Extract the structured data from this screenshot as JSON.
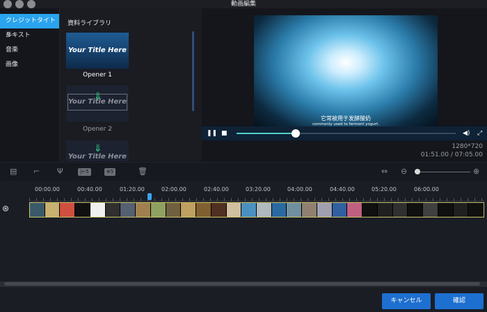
{
  "window": {
    "title": "動画編集"
  },
  "categories": [
    {
      "label": "クレジットタイトル",
      "active": true
    },
    {
      "label": "テキスト",
      "active": false
    },
    {
      "label": "音楽",
      "active": false
    },
    {
      "label": "画像",
      "active": false
    }
  ],
  "library": {
    "title": "資料ライブラリ",
    "items": [
      {
        "thumb_text": "Your Title Here",
        "label": "Opener 1"
      },
      {
        "thumb_text": "Your Title Here",
        "label": "Opener 2"
      },
      {
        "thumb_text": "Your Title Here",
        "label": ""
      }
    ]
  },
  "preview": {
    "subtitle_jp": "它常被用于发酵酸奶",
    "subtitle_en": "commonly used to ferment yogurt.",
    "progress": 0.27,
    "resolution": "1280*720",
    "time": "01:51.00 / 07:05.00"
  },
  "toolbar": {
    "split_label": "|←5",
    "merge_label": "⊕5"
  },
  "timeline": {
    "ruler": [
      "00:00.00",
      "00:40.00",
      "01:20.00",
      "02:00.00",
      "02:40.00",
      "03:20.00",
      "04:00.00",
      "04:40.00",
      "05:20.00",
      "06:00.00"
    ]
  },
  "footer": {
    "cancel_label": "キャンセル",
    "confirm_label": "確認"
  },
  "colors": {
    "accent": "#2aa4ee",
    "button": "#1d6fd0",
    "seek": "#4fd0c8"
  }
}
